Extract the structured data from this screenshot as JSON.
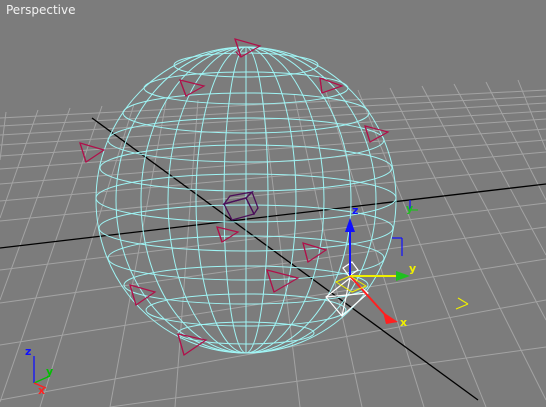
{
  "viewport": {
    "label": "Perspective",
    "background": "#7c7c7c",
    "grid_color": "#a2a2a2",
    "grid_major_color": "#000000",
    "sphere_wire_color": "#9ff4f4",
    "camera_color": "#b0104a",
    "selected_color": "#ffffff",
    "highlight_color": "#6a1d6a"
  },
  "gizmo": {
    "x_label": "x",
    "y_label": "y",
    "z_label": "z",
    "x_color": "#ff2020",
    "y_color": "#f0f000",
    "z_color": "#1010ff",
    "center_color": "#00e000"
  },
  "corner_axis": {
    "x_label": "x",
    "y_label": "y",
    "z_label": "z"
  },
  "secondary_gizmo": {
    "y_label": "y",
    "z_label": "z"
  },
  "objects": [
    {
      "name": "camera",
      "kind": "camera"
    },
    {
      "name": "camera",
      "kind": "camera"
    },
    {
      "name": "camera",
      "kind": "camera"
    },
    {
      "name": "camera",
      "kind": "camera"
    },
    {
      "name": "camera",
      "kind": "camera"
    },
    {
      "name": "camera",
      "kind": "camera"
    },
    {
      "name": "camera",
      "kind": "camera"
    },
    {
      "name": "camera",
      "kind": "camera"
    },
    {
      "name": "camera",
      "kind": "camera"
    },
    {
      "name": "camera",
      "kind": "camera"
    },
    {
      "name": "camera",
      "kind": "camera"
    }
  ]
}
